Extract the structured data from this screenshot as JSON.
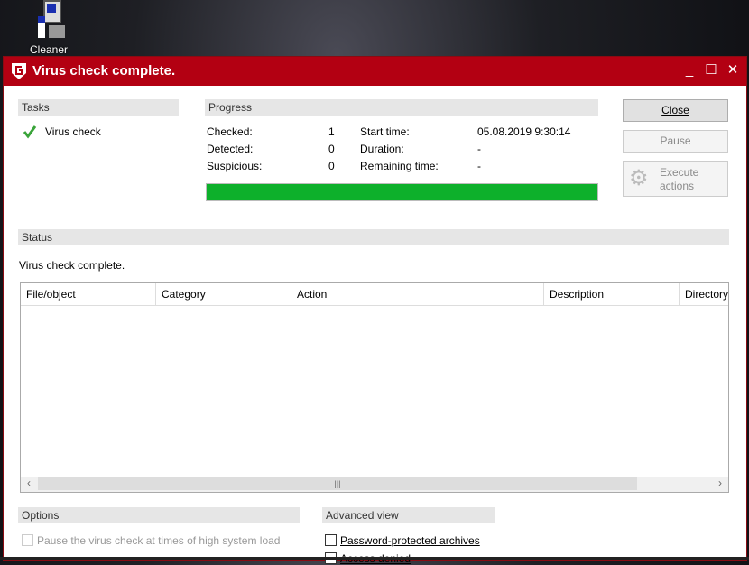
{
  "desktop": {
    "icon_label": "Cleaner"
  },
  "window": {
    "title": "Virus check complete.",
    "minimize": "_",
    "maximize": "☐",
    "close": "✕",
    "brand_color": "#b30012"
  },
  "tasks": {
    "header": "Tasks",
    "items": [
      {
        "label": "Virus check",
        "status": "complete"
      }
    ]
  },
  "progress": {
    "header": "Progress",
    "checked_label": "Checked:",
    "checked": "1",
    "detected_label": "Detected:",
    "detected": "0",
    "suspicious_label": "Suspicious:",
    "suspicious": "0",
    "start_label": "Start time:",
    "start": "05.08.2019 9:30:14",
    "duration_label": "Duration:",
    "duration": "-",
    "remaining_label": "Remaining time:",
    "remaining": "-",
    "percent": 100,
    "bar_color": "#0db02b"
  },
  "buttons": {
    "close": "Close",
    "pause": "Pause",
    "execute_line1": "Execute",
    "execute_line2": "actions"
  },
  "status": {
    "header": "Status",
    "text": "Virus check complete."
  },
  "table": {
    "columns": [
      "File/object",
      "Category",
      "Action",
      "Description",
      "Directory"
    ],
    "rows": []
  },
  "options": {
    "header": "Options",
    "pause_label": "Pause the virus check at times of high system load",
    "pause_checked": false
  },
  "advanced": {
    "header": "Advanced view",
    "items": [
      {
        "label": "Password-protected archives",
        "checked": false
      },
      {
        "label": "Access denied",
        "checked": false
      }
    ]
  }
}
